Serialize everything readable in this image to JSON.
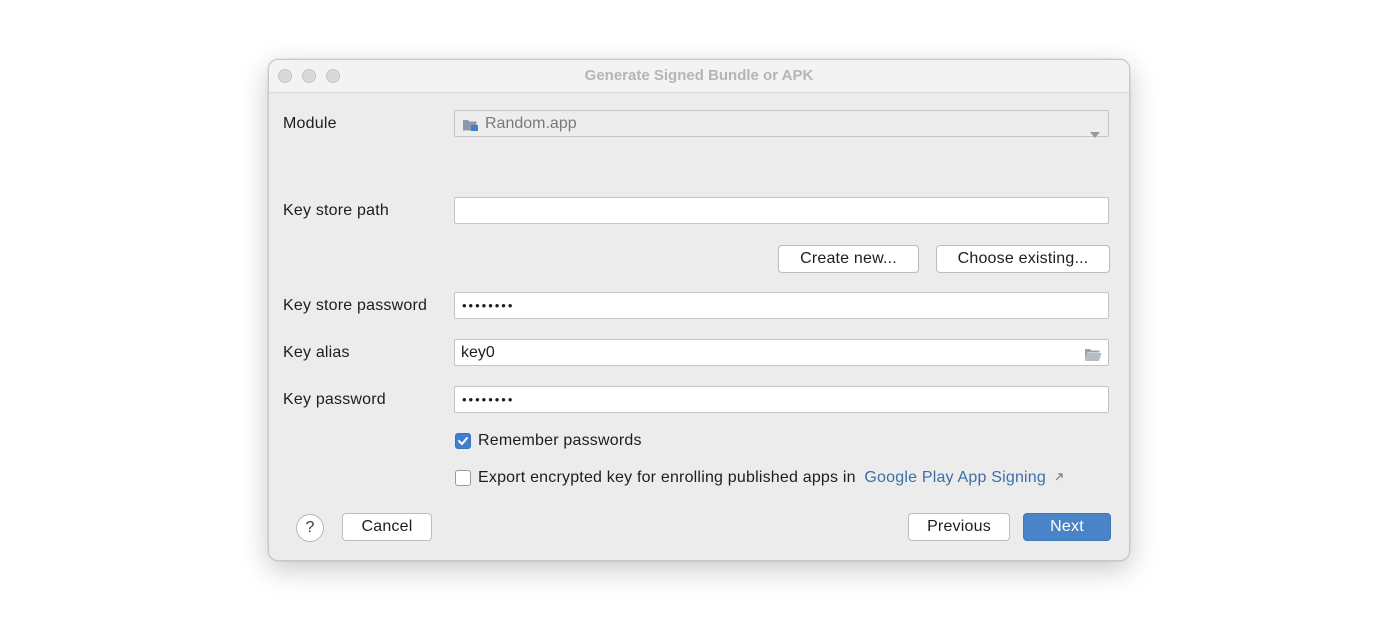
{
  "window": {
    "title": "Generate Signed Bundle or APK"
  },
  "module": {
    "label": "Module",
    "value": "Random.app",
    "icon": "module-folder-icon"
  },
  "keystore": {
    "path_label": "Key store path",
    "path_value": "",
    "create_new_label": "Create new...",
    "choose_existing_label": "Choose existing...",
    "password_label": "Key store password",
    "password_mask": "••••••••"
  },
  "key": {
    "alias_label": "Key alias",
    "alias_value": "key0",
    "alias_icon": "folder-icon",
    "password_label": "Key password",
    "password_mask": "••••••••"
  },
  "options": {
    "remember_label": "Remember passwords",
    "remember_checked": true,
    "export_label": "Export encrypted key for enrolling published apps in",
    "export_checked": false,
    "export_link": "Google Play App Signing",
    "export_link_icon": "external-link-arrow-icon"
  },
  "footer": {
    "help_label": "?",
    "cancel_label": "Cancel",
    "previous_label": "Previous",
    "next_label": "Next"
  },
  "colors": {
    "primary_button": "#4a84c8",
    "checkbox_checked": "#3f7fd0",
    "link": "#3d6fa8"
  }
}
